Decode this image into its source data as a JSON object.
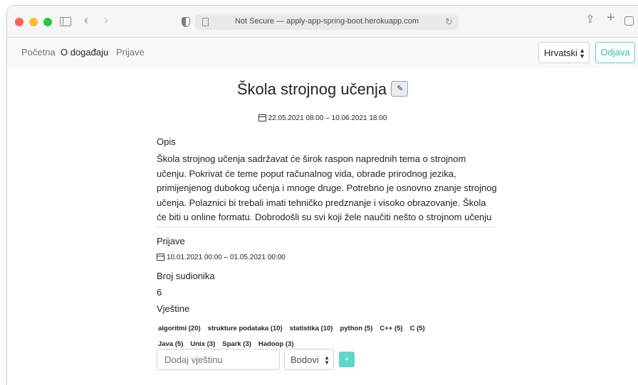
{
  "browser": {
    "url": "Not Secure — apply-app-spring-boot.herokuapp.com"
  },
  "nav": {
    "links": [
      "Početna",
      "O događaju",
      "Prijave"
    ],
    "language": "Hrvatski",
    "logout": "Odjava"
  },
  "event": {
    "title": "Škola strojnog učenja",
    "dates": "22.05.2021 08:00 – 10.06.2021 18:00",
    "description_label": "Opis",
    "description": "Škola strojnog učenja sadržavat će širok raspon naprednih tema o strojnom učenju. Pokrivat će teme poput računalnog vida, obrade prirodnog jezika, primijenjenog dubokog učenja i mnoge druge. Potrebno je osnovno znanje strojnog učenja. Polaznici bi trebali imati tehničko predznanje i visoko obrazovanje. Škola će biti u online formatu. Dobrodošli su svi koji žele naučiti nešto o strojnom učenju",
    "applications_label": "Prijave",
    "applications_dates": "10.01.2021 00:00 – 01.05.2021 00:00",
    "participants_label": "Broj sudionika",
    "participants_value": "6",
    "skills_label": "Vještine",
    "skills": [
      "algoritmi (20)",
      "strukture podataka (10)",
      "statistika (10)",
      "python (5)",
      "C++ (5)",
      "C (5)",
      "Java (5)",
      "Unix (3)",
      "Spark (3)",
      "Hadoop (3)"
    ],
    "skill_placeholder": "Dodaj vještinu",
    "points_placeholder": "Bodovi",
    "add_button": "+"
  }
}
